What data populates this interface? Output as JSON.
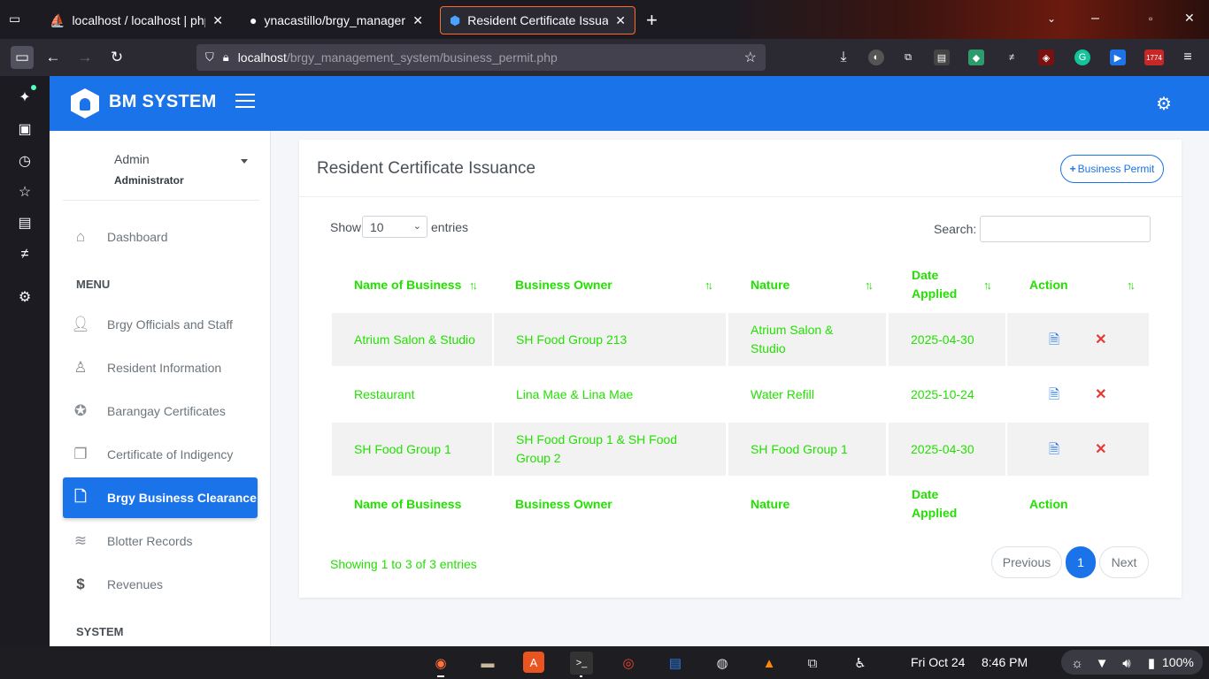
{
  "browser": {
    "tabs": [
      {
        "title": "localhost / localhost | php",
        "icon": "phpmyadmin-icon",
        "active": false
      },
      {
        "title": "ynacastillo/brgy_manager",
        "icon": "github-icon",
        "active": false
      },
      {
        "title": "Resident Certificate Issuar",
        "icon": "app-shield-icon",
        "active": true
      }
    ],
    "new_tab": "+",
    "url_host": "localhost",
    "url_path": "/brgy_management_system/business_permit.php",
    "notification_badge": "1774"
  },
  "app": {
    "brand": "BM SYSTEM",
    "accent": "#1a73e8",
    "user": {
      "name": "Admin",
      "role": "Administrator"
    },
    "sidebar": {
      "dashboard": "Dashboard",
      "menu_heading": "MENU",
      "items": [
        {
          "label": "Brgy Officials and Staff",
          "icon": "user-icon"
        },
        {
          "label": "Resident Information",
          "icon": "users-icon"
        },
        {
          "label": "Barangay Certificates",
          "icon": "award-icon"
        },
        {
          "label": "Certificate of Indigency",
          "icon": "files-icon"
        },
        {
          "label": "Brgy Business Clearance",
          "icon": "file-icon",
          "active": true
        },
        {
          "label": "Blotter Records",
          "icon": "layers-icon"
        },
        {
          "label": "Revenues",
          "icon": "dollar-icon"
        }
      ],
      "system_heading": "SYSTEM"
    },
    "card": {
      "title": "Resident Certificate Issuance",
      "add_button": "Business Permit",
      "show_label": "Show",
      "entries_select": "10",
      "entries_label": "entries",
      "search_label": "Search:",
      "search_value": "",
      "headers": [
        "Name of Business",
        "Business Owner",
        "Nature",
        "Date Applied",
        "Action"
      ],
      "rows": [
        {
          "business": "Atrium Salon & Studio",
          "owner": "SH Food Group 213",
          "nature": "Atrium Salon & Studio",
          "date": "2025-04-30"
        },
        {
          "business": "Restaurant",
          "owner": "Lina Mae & Lina Mae",
          "nature": "Water Refill",
          "date": "2025-10-24"
        },
        {
          "business": "SH Food Group 1",
          "owner": "SH Food Group 1 & SH Food Group 2",
          "nature": "SH Food Group 1",
          "date": "2025-04-30"
        }
      ],
      "info": "Showing 1 to 3 of 3 entries",
      "pagination": {
        "previous": "Previous",
        "page": "1",
        "next": "Next"
      }
    }
  },
  "taskbar": {
    "date": "Fri Oct 24",
    "time": "8:46 PM",
    "battery": "100%"
  }
}
